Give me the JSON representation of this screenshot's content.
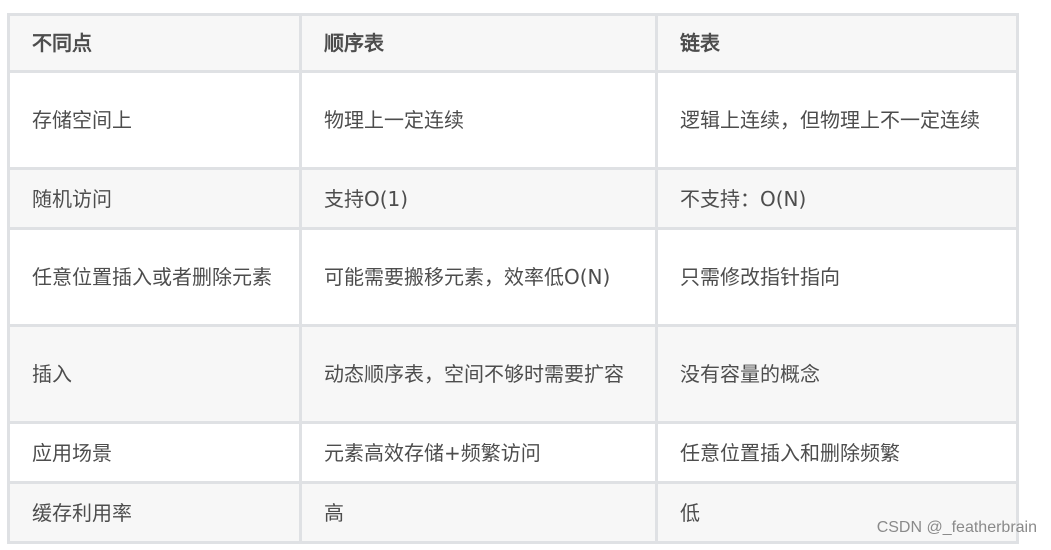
{
  "table": {
    "headers": [
      "不同点",
      "顺序表",
      "链表"
    ],
    "rows": [
      [
        "存储空间上",
        "物理上一定连续",
        "逻辑上连续，但物理上不一定连续"
      ],
      [
        "随机访问",
        "支持O(1)",
        "不支持：O(N)"
      ],
      [
        "任意位置插入或者删除元素",
        "可能需要搬移元素，效率低O(N)",
        "只需修改指针指向"
      ],
      [
        "插入",
        "动态顺序表，空间不够时需要扩容",
        "没有容量的概念"
      ],
      [
        "应用场景",
        "元素高效存储+频繁访问",
        "任意位置插入和删除频繁"
      ],
      [
        "缓存利用率",
        "高",
        "低"
      ]
    ]
  },
  "watermark": "CSDN @_featherbrain"
}
